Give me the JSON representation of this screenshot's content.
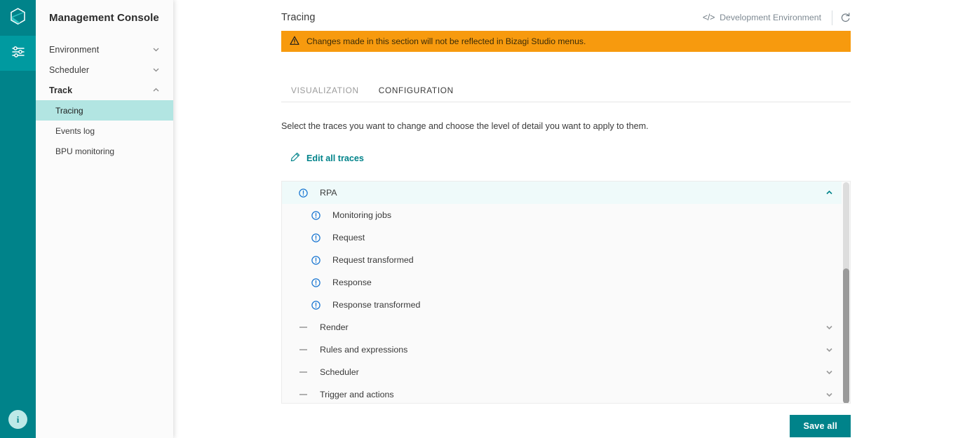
{
  "rail": {
    "logo_icon": "hexagon-logo-icon",
    "settings_icon": "sliders-icon",
    "help_label": "i",
    "accent": "#00838a"
  },
  "sidebar": {
    "title": "Management Console",
    "groups": [
      {
        "label": "Environment",
        "icon": "chevron-down-icon",
        "expanded": false
      },
      {
        "label": "Scheduler",
        "icon": "chevron-down-icon",
        "expanded": false
      },
      {
        "label": "Track",
        "icon": "chevron-up-icon",
        "expanded": true
      }
    ],
    "track_items": [
      {
        "label": "Tracing",
        "active": true
      },
      {
        "label": "Events log",
        "active": false
      },
      {
        "label": "BPU monitoring",
        "active": false
      }
    ]
  },
  "header": {
    "title": "Tracing",
    "env_code_icon": "code-brackets-icon",
    "environment": "Development Environment",
    "refresh_icon": "refresh-icon"
  },
  "banner": {
    "icon": "warning-triangle-icon",
    "text": "Changes made in this section will not be reflected in Bizagi Studio menus.",
    "background": "#f79a0e"
  },
  "tabs": [
    {
      "label": "VISUALIZATION",
      "active": false
    },
    {
      "label": "CONFIGURATION",
      "active": true
    }
  ],
  "body": {
    "helper_text": "Select the traces you want to change and choose the level of detail you want to apply to them.",
    "edit_all_icon": "pencil-icon",
    "edit_all_label": "Edit all traces"
  },
  "trace_list": {
    "rows": [
      {
        "label": "RPA",
        "icon": "info-circle-icon",
        "indent": 0,
        "selected": true,
        "chevron": "chevron-up-icon"
      },
      {
        "label": "Monitoring jobs",
        "icon": "info-circle-icon",
        "indent": 1,
        "selected": false,
        "chevron": ""
      },
      {
        "label": "Request",
        "icon": "info-circle-icon",
        "indent": 1,
        "selected": false,
        "chevron": ""
      },
      {
        "label": "Request transformed",
        "icon": "info-circle-icon",
        "indent": 1,
        "selected": false,
        "chevron": ""
      },
      {
        "label": "Response",
        "icon": "info-circle-icon",
        "indent": 1,
        "selected": false,
        "chevron": ""
      },
      {
        "label": "Response transformed",
        "icon": "info-circle-icon",
        "indent": 1,
        "selected": false,
        "chevron": ""
      },
      {
        "label": "Render",
        "icon": "dash-icon",
        "indent": 0,
        "selected": false,
        "chevron": "chevron-down-icon"
      },
      {
        "label": "Rules and expressions",
        "icon": "dash-icon",
        "indent": 0,
        "selected": false,
        "chevron": "chevron-down-icon"
      },
      {
        "label": "Scheduler",
        "icon": "dash-icon",
        "indent": 0,
        "selected": false,
        "chevron": "chevron-down-icon"
      },
      {
        "label": "Trigger and actions",
        "icon": "dash-icon",
        "indent": 0,
        "selected": false,
        "chevron": "chevron-down-icon"
      }
    ],
    "scrollbar": {
      "thumb_top_pct": 39,
      "thumb_height_pct": 61
    }
  },
  "footer": {
    "save_label": "Save all"
  }
}
